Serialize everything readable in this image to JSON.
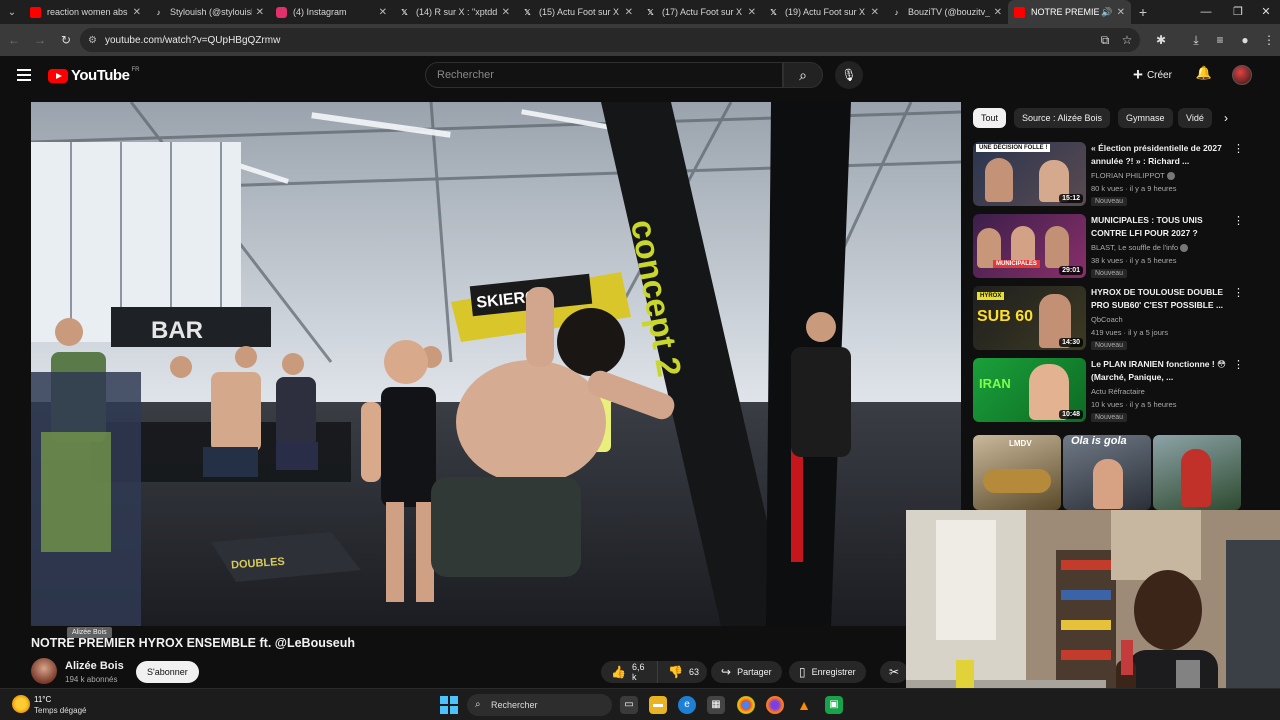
{
  "browser": {
    "tabs": [
      {
        "label": "reaction women abs",
        "icon": "youtube-icon",
        "color": "#ff0000",
        "active": false
      },
      {
        "label": "Stylouish (@stylouish",
        "icon": "tiktok-icon",
        "color": "#ffffff",
        "active": false
      },
      {
        "label": "(4) Instagram",
        "icon": "instagram-icon",
        "color": "#e1306c",
        "active": false
      },
      {
        "label": "(14) R sur X : \"xptdd",
        "icon": "x-icon",
        "color": "#ffffff",
        "active": false
      },
      {
        "label": "(15) Actu Foot sur X",
        "icon": "x-icon",
        "color": "#ffffff",
        "active": false
      },
      {
        "label": "(17) Actu Foot sur X",
        "icon": "x-icon",
        "color": "#ffffff",
        "active": false
      },
      {
        "label": "(19) Actu Foot sur X",
        "icon": "x-icon",
        "color": "#ffffff",
        "active": false
      },
      {
        "label": "BouziTV (@bouzitv_)",
        "icon": "tiktok-icon",
        "color": "#ffffff",
        "active": false
      },
      {
        "label": "NOTRE PREMIER",
        "icon": "youtube-icon",
        "color": "#ff0000",
        "active": true
      }
    ],
    "url": "youtube.com/watch?v=QUpHBgQZrmw"
  },
  "youtube": {
    "logo_text": "YouTube",
    "country_code": "FR",
    "search_placeholder": "Rechercher",
    "create_label": "Créer"
  },
  "video": {
    "title": "NOTRE PREMIER HYROX ENSEMBLE ft. @LeBouseuh",
    "tooltip": "Alizée Bois",
    "channel_name": "Alizée Bois",
    "subscribers": "194 k abonnés",
    "subscribe_label": "S'abonner",
    "likes": "6,6 k",
    "dislikes": "63",
    "share_label": "Partager",
    "save_label": "Enregistrer",
    "scene_sign_left": "BAR",
    "scene_sign_skierg": "SKIERG",
    "scene_concept": "concept 2",
    "scene_doubles": "DOUBLES"
  },
  "sidebar": {
    "chips": [
      "Tout",
      "Source : Alizée Bois",
      "Gymnase",
      "Vidé"
    ],
    "recommendations": [
      {
        "title": "« Élection présidentielle de 2027 annulée ?! » : Richard ...",
        "channel": "FLORIAN PHILIPPOT",
        "verified": true,
        "meta": "80 k vues · il y a 9 heures",
        "badge": "Nouveau",
        "duration": "15:12",
        "thumb_text": "UNE DÉCISION FOLLE !",
        "thumb_color": "#2a3550"
      },
      {
        "title": "MUNICIPALES : TOUS UNIS CONTRE LFI POUR 2027 ?",
        "channel": "BLAST, Le souffle de l'info",
        "verified": true,
        "meta": "38 k vues · il y a 5 heures",
        "badge": "Nouveau",
        "duration": "29:01",
        "thumb_text": "MUNICIPALES",
        "thumb_color": "#6a2a6e"
      },
      {
        "title": "HYROX DE TOULOUSE DOUBLE PRO SUB60' C'EST POSSIBLE ...",
        "channel": "QbCoach",
        "verified": false,
        "meta": "419 vues · il y a 5 jours",
        "badge": "Nouveau",
        "duration": "14:30",
        "thumb_text": "SUB 60",
        "thumb_color": "#2b2b2b"
      },
      {
        "title": "Le PLAN IRANIEN fonctionne ! 😳 (Marché, Panique, ...",
        "channel": "Actu Réfractaire",
        "verified": false,
        "meta": "10 k vues · il y a 5 heures",
        "badge": "Nouveau",
        "duration": "10:48",
        "thumb_text": "IRAN",
        "thumb_color": "#1f9a3a"
      }
    ],
    "shorts_text": [
      "LMDV",
      "Ola is gola"
    ]
  },
  "taskbar": {
    "temperature": "11°C",
    "weather": "Temps dégagé",
    "search_label": "Rechercher"
  }
}
